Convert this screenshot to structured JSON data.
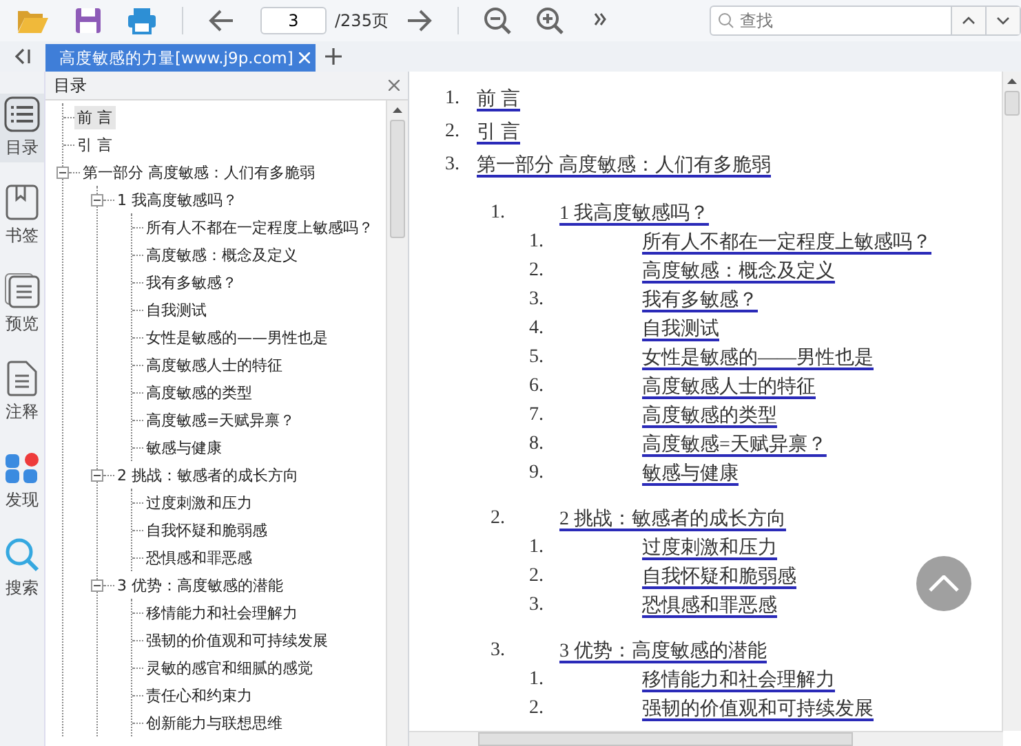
{
  "toolbar": {
    "page_input": "3",
    "page_total": "/235页",
    "search": {
      "placeholder": "查找"
    }
  },
  "tabs": [
    {
      "label": "高度敏感的力量[www.j9p.com]",
      "selected": true
    }
  ],
  "rail": [
    {
      "label": "目录",
      "kind": "toc",
      "selected": true
    },
    {
      "label": "书签",
      "kind": "bookmark",
      "selected": false
    },
    {
      "label": "预览",
      "kind": "preview",
      "selected": false
    },
    {
      "label": "注释",
      "kind": "note",
      "selected": false
    },
    {
      "label": "发现",
      "kind": "discover",
      "selected": false
    },
    {
      "label": "搜索",
      "kind": "search",
      "selected": false
    }
  ],
  "toc_panel": {
    "title": "目录",
    "items": [
      {
        "label": "前 言",
        "selected": true
      },
      {
        "label": "引 言",
        "selected": false
      },
      {
        "label": "第一部分 高度敏感：人们有多脆弱",
        "selected": false,
        "expanded": true,
        "children": [
          {
            "label": "1 我高度敏感吗？",
            "selected": false,
            "expanded": true,
            "children": [
              {
                "label": "所有人不都在一定程度上敏感吗？",
                "selected": false
              },
              {
                "label": "高度敏感：概念及定义",
                "selected": false
              },
              {
                "label": "我有多敏感？",
                "selected": false
              },
              {
                "label": "自我测试",
                "selected": false
              },
              {
                "label": "女性是敏感的——男性也是",
                "selected": false
              },
              {
                "label": "高度敏感人士的特征",
                "selected": false
              },
              {
                "label": "高度敏感的类型",
                "selected": false
              },
              {
                "label": "高度敏感=天赋异禀？",
                "selected": false
              },
              {
                "label": "敏感与健康",
                "selected": false
              }
            ]
          },
          {
            "label": "2 挑战：敏感者的成长方向",
            "selected": false,
            "expanded": true,
            "children": [
              {
                "label": "过度刺激和压力",
                "selected": false
              },
              {
                "label": "自我怀疑和脆弱感",
                "selected": false
              },
              {
                "label": "恐惧感和罪恶感",
                "selected": false
              }
            ]
          },
          {
            "label": "3 优势：高度敏感的潜能",
            "selected": false,
            "expanded": true,
            "children": [
              {
                "label": "移情能力和社会理解力",
                "selected": false
              },
              {
                "label": "强韧的价值观和可持续发展",
                "selected": false
              },
              {
                "label": "灵敏的感官和细腻的感觉",
                "selected": false
              },
              {
                "label": "责任心和约束力",
                "selected": false
              },
              {
                "label": "创新能力与联想思维",
                "selected": false
              }
            ]
          }
        ]
      }
    ]
  },
  "document": {
    "items": [
      {
        "number": "1.",
        "text": "前 言"
      },
      {
        "number": "2.",
        "text": "引 言"
      },
      {
        "number": "3.",
        "text": "第一部分 高度敏感：人们有多脆弱",
        "children": [
          {
            "number": "1.",
            "text": "1 我高度敏感吗？",
            "children": [
              {
                "number": "1.",
                "text": "所有人不都在一定程度上敏感吗？"
              },
              {
                "number": "2.",
                "text": "高度敏感：概念及定义"
              },
              {
                "number": "3.",
                "text": "我有多敏感？"
              },
              {
                "number": "4.",
                "text": "自我测试"
              },
              {
                "number": "5.",
                "text": "女性是敏感的——男性也是"
              },
              {
                "number": "6.",
                "text": "高度敏感人士的特征"
              },
              {
                "number": "7.",
                "text": "高度敏感的类型"
              },
              {
                "number": "8.",
                "text": "高度敏感=天赋异禀？"
              },
              {
                "number": "9.",
                "text": "敏感与健康"
              }
            ]
          },
          {
            "number": "2.",
            "text": "2 挑战：敏感者的成长方向",
            "children": [
              {
                "number": "1.",
                "text": "过度刺激和压力"
              },
              {
                "number": "2.",
                "text": "自我怀疑和脆弱感"
              },
              {
                "number": "3.",
                "text": "恐惧感和罪恶感"
              }
            ]
          },
          {
            "number": "3.",
            "text": "3 优势：高度敏感的潜能",
            "children": [
              {
                "number": "1.",
                "text": "移情能力和社会理解力"
              },
              {
                "number": "2.",
                "text": "强韧的价值观和可持续发展"
              }
            ]
          }
        ]
      }
    ]
  }
}
